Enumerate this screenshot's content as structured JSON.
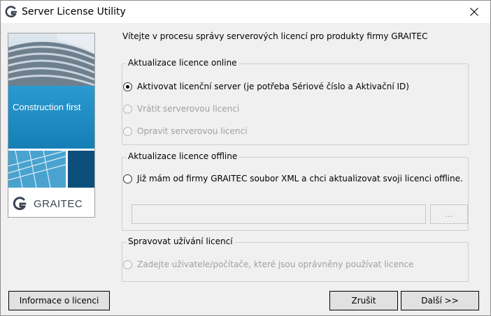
{
  "window": {
    "title": "Server License Utility"
  },
  "banner": {
    "tagline": "Construction first",
    "brand": "GRAITEC"
  },
  "intro": "Vítejte v procesu správy serverových licencí pro produkty firmy GRAITEC",
  "online_group": {
    "legend": "Aktualizace licence online",
    "options": [
      {
        "label": "Aktivovat licenční server (je potřeba Sériové číslo a Aktivační ID)",
        "checked": true,
        "enabled": true
      },
      {
        "label": "Vrátit serverovou licenci",
        "checked": false,
        "enabled": false
      },
      {
        "label": "Opravit serverovou licenci",
        "checked": false,
        "enabled": false
      }
    ]
  },
  "offline_group": {
    "legend": "Aktualizace licence offline",
    "option": {
      "label": "Již mám od firmy GRAITEC soubor XML a chci aktualizovat svoji licenci offline.",
      "checked": false,
      "enabled": true
    },
    "path_value": "",
    "browse_label": "..."
  },
  "usage_group": {
    "legend": "Spravovat užívání licencí",
    "option": {
      "label": "Zadejte uživatele/počítače, které jsou oprávněny používat licence",
      "checked": false,
      "enabled": false
    }
  },
  "buttons": {
    "license_info": "Informace o licenci",
    "cancel": "Zrušit",
    "next": "Další >>"
  },
  "colors": {
    "banner_blue": "#1f8fc4",
    "banner_dark": "#0d4f7a",
    "brand_text": "#3a4350"
  }
}
